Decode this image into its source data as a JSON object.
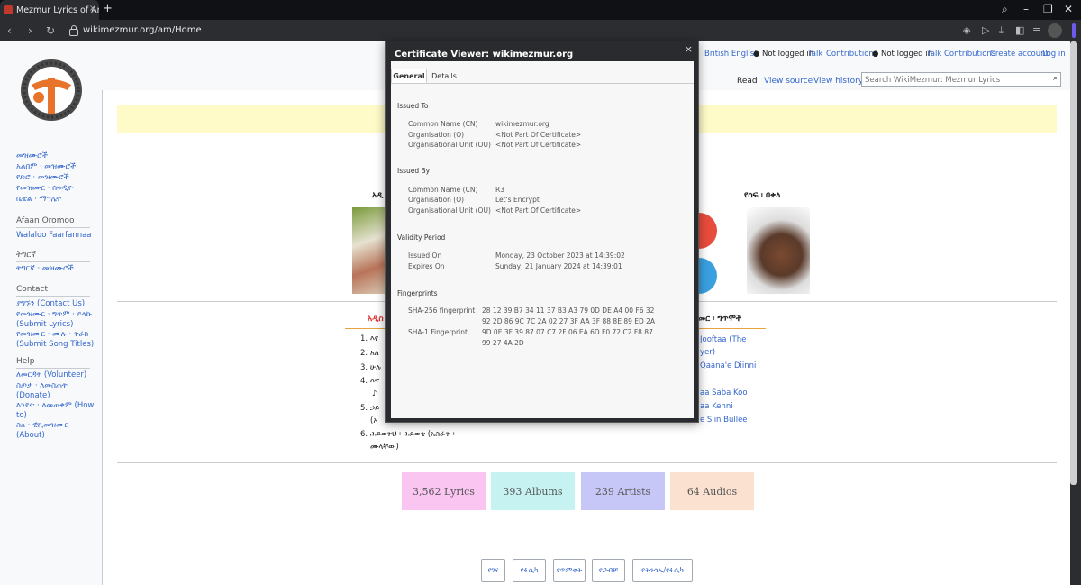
{
  "browser": {
    "tab_title": "Mezmur Lyrics of Amharic",
    "new_tab": "+",
    "url": "wikimezmur.org/am/Home"
  },
  "sidebar": {
    "links_main": [
      "መዝሙሮች",
      "አልበም · መዝሙሮች",
      "የድሮ · መዝሙሮች",
      "የመዝሙር · ስቱዲዮ",
      "ቤቴል · ማኅሌት"
    ],
    "oromoo_head": "Afaan Oromoo",
    "oromoo_links": [
      "Walaloo Faarfannaa"
    ],
    "tigrinya_head": "ትግርኛ",
    "tigrinya_links": [
      "ትግርኛ · መዝሙሮች"
    ],
    "contact_head": "Contact",
    "contact_links": [
      "ያግኙን (Contact Us)",
      "የመዝሙር · ግጥም · ይላኩ (Submit Lyrics)",
      "የመዝሙር · ሙሉ · ትራክ (Submit Song Titles)"
    ],
    "help_head": "Help",
    "help_links": [
      "ለመርዳት (Volunteer)",
      "ስጦታ · ለመስጠት (Donate)",
      "እንዴት · ለመጠቀም (How to)",
      "ስለ · ዊኪመዝሙር (About)"
    ]
  },
  "header": {
    "personal": {
      "lang": "British English",
      "not_logged_1": "Not logged in",
      "talk_1": "Talk",
      "contrib_1": "Contributions",
      "not_logged_2": "Not logged in",
      "talk_2": "Talk",
      "contrib_2": "Contributions",
      "create": "Create account",
      "login": "Log in"
    },
    "views": {
      "read": "Read",
      "source": "View source",
      "history": "View history"
    },
    "search_placeholder": "Search WikiMezmur: Mezmur Lyrics"
  },
  "main": {
    "section_left": "አዲ",
    "section_right": "የሰፍ ፡ በቀለ",
    "list_head_left": "አዲስ",
    "list_head_right": "መር ፡ ግጥሞች",
    "left_list": [
      {
        "n": "1.",
        "t": "እየ"
      },
      {
        "n": "2.",
        "t": "አለ"
      },
      {
        "n": "3.",
        "t": "ሁሉ"
      },
      {
        "n": "4.",
        "t": "እኖ"
      },
      {
        "n": "",
        "t": "♪"
      },
      {
        "n": "5.",
        "t": "ኃይ"
      },
      {
        "n": "",
        "t": "(አ"
      },
      {
        "n": "6.",
        "t": "ሕይወትህ ፡ ሕይወቴ (አስራት ፡"
      },
      {
        "n": "",
        "t": "ሙላቸው)"
      }
    ],
    "right_list": [
      "Jooftaa (The",
      "yer)",
      "Qaana'e Diinni",
      "aa Saba Koo",
      "aa Kenni",
      "e Siin Bullee"
    ],
    "stats": {
      "lyrics": "3,562 Lyrics",
      "albums": "393 Albums",
      "artists": "239 Artists",
      "audios": "64 Audios"
    },
    "nav_buttons": [
      "የገና",
      "የፋሲካ",
      "የጥምቀት",
      "የጋብቻ",
      "የትንሳኤ/የፋሲካ"
    ]
  },
  "certificate": {
    "title": "Certificate Viewer: wikimezmur.org",
    "close": "×",
    "tabs": [
      "General",
      "Details"
    ],
    "issued_to_head": "Issued To",
    "issued_to": [
      {
        "label": "Common Name (CN)",
        "value": "wikimezmur.org"
      },
      {
        "label": "Organisation (O)",
        "value": "<Not Part Of Certificate>"
      },
      {
        "label": "Organisational Unit (OU)",
        "value": "<Not Part Of Certificate>"
      }
    ],
    "issued_by_head": "Issued By",
    "issued_by": [
      {
        "label": "Common Name (CN)",
        "value": "R3"
      },
      {
        "label": "Organisation (O)",
        "value": "Let's Encrypt"
      },
      {
        "label": "Organisational Unit (OU)",
        "value": "<Not Part Of Certificate>"
      }
    ],
    "validity_head": "Validity Period",
    "validity": [
      {
        "label": "Issued On",
        "value": "Monday, 23 October 2023 at 14:39:02"
      },
      {
        "label": "Expires On",
        "value": "Sunday, 21 January 2024 at 14:39:01"
      }
    ],
    "fingerprints_head": "Fingerprints",
    "sha256_label": "SHA-256 fingerprint",
    "sha256_line1": "28 12 39 B7 34 11 37 B3 A3 79 0D DE A4 00 F6 32",
    "sha256_line2": "92 2D 86 9C 7C 2A 02 27 3F AA 3F 88 8E 89 ED 2A",
    "sha1_label": "SHA-1 Fingerprint",
    "sha1_line1": "9D 0E 3F 39 87 07 C7 2F 06 EA 6D F0 72 C2 F8 87",
    "sha1_line2": "99 27 4A 2D"
  }
}
